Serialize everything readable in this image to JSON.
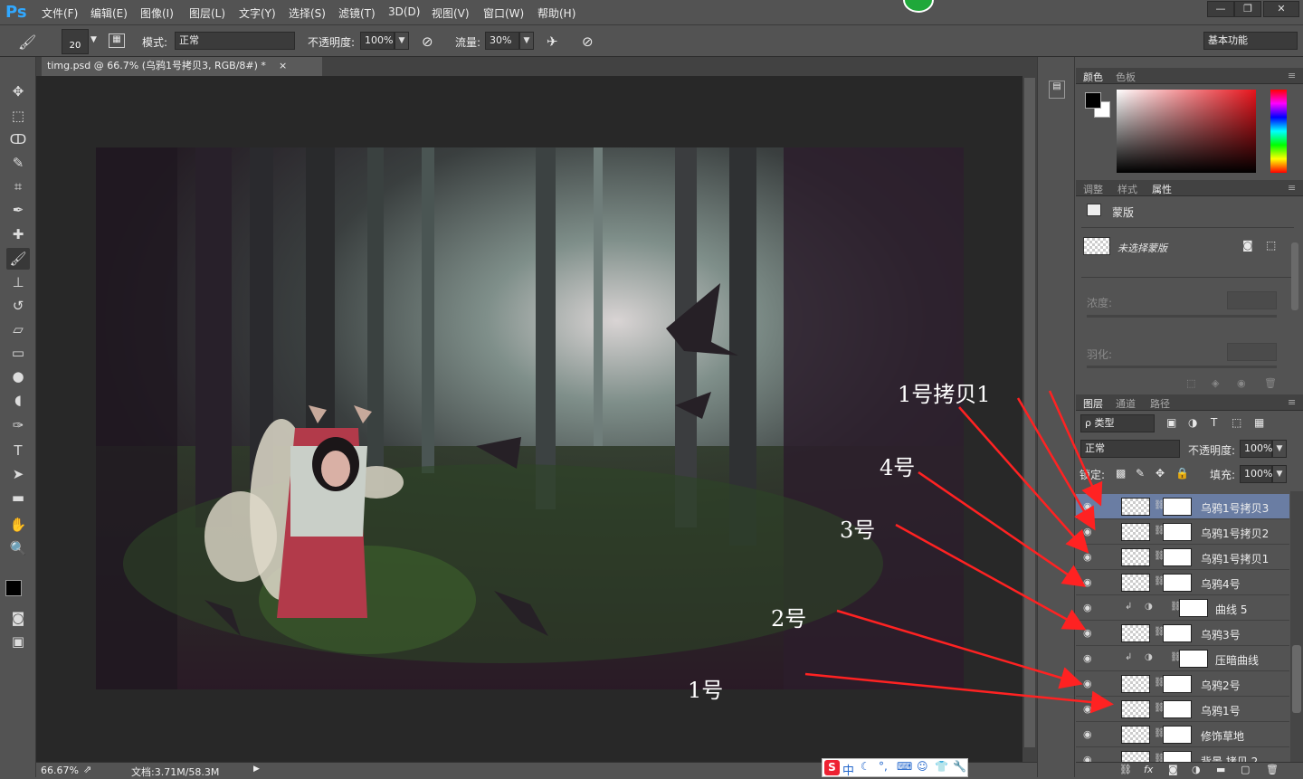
{
  "app": {
    "logo": "Ps"
  },
  "menu": [
    "文件(F)",
    "编辑(E)",
    "图像(I)",
    "图层(L)",
    "文字(Y)",
    "选择(S)",
    "滤镜(T)",
    "3D(D)",
    "视图(V)",
    "窗口(W)",
    "帮助(H)"
  ],
  "window_controls": {
    "minimize": "—",
    "restore": "❐",
    "close": "✕"
  },
  "options": {
    "brush_size": "20",
    "mode_label": "模式:",
    "mode_value": "正常",
    "opacity_label": "不透明度:",
    "opacity_value": "100%",
    "flow_label": "流量:",
    "flow_value": "30%",
    "workspace": "基本功能"
  },
  "document": {
    "tab_title": "timg.psd @ 66.7% (乌鸦1号拷贝3, RGB/8#) *",
    "close": "×"
  },
  "status": {
    "zoom": "66.67%",
    "doc_size": "文档:3.71M/58.3M"
  },
  "color_panel": {
    "tabs": [
      "颜色",
      "色板"
    ],
    "fg": "#000000",
    "bg": "#ffffff"
  },
  "props_panel": {
    "tabs": [
      "调整",
      "样式",
      "属性"
    ],
    "title": "蒙版",
    "mask_status": "未选择蒙版",
    "density_label": "浓度:",
    "feather_label": "羽化:"
  },
  "layers_panel": {
    "tabs": [
      "图层",
      "通道",
      "路径"
    ],
    "filter": "ρ 类型",
    "blend": "正常",
    "opacity_label": "不透明度:",
    "opacity_value": "100%",
    "lock_label": "锁定:",
    "fill_label": "填充:",
    "fill_value": "100%",
    "layers": [
      {
        "name": "乌鸦1号拷贝3",
        "selected": true
      },
      {
        "name": "乌鸦1号拷贝2",
        "selected": false
      },
      {
        "name": "乌鸦1号拷贝1",
        "selected": false
      },
      {
        "name": "乌鸦4号",
        "selected": false
      },
      {
        "name": "曲线 5",
        "selected": false,
        "adjustment": true
      },
      {
        "name": "乌鸦3号",
        "selected": false
      },
      {
        "name": "压暗曲线",
        "selected": false,
        "adjustment": true
      },
      {
        "name": "乌鸦2号",
        "selected": false
      },
      {
        "name": "乌鸦1号",
        "selected": false
      },
      {
        "name": "修饰草地",
        "selected": false
      },
      {
        "name": "背景 拷贝 2",
        "selected": false
      }
    ],
    "footer_icons": [
      "link-icon",
      "fx-icon",
      "mask-icon",
      "adjustment-icon",
      "folder-icon",
      "new-layer-icon",
      "trash-icon"
    ]
  },
  "annotations": [
    "1号拷贝1",
    "4号",
    "3号",
    "2号",
    "1号"
  ],
  "ime": {
    "label": "中"
  },
  "colors": {
    "accent_ps": "#31a8ff",
    "arrow": "#ff2222",
    "selected_layer": "#6a7da3"
  }
}
